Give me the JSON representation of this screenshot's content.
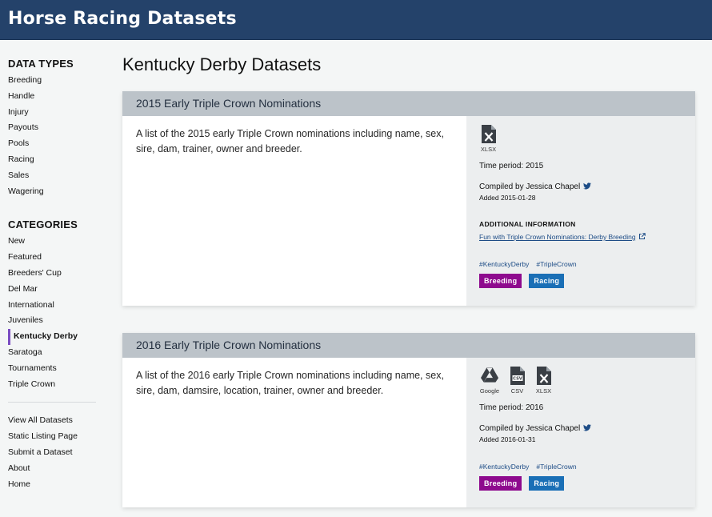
{
  "header": {
    "title": "Horse Racing Datasets"
  },
  "sidebar": {
    "data_types_heading": "DATA TYPES",
    "data_types": [
      "Breeding",
      "Handle",
      "Injury",
      "Payouts",
      "Pools",
      "Racing",
      "Sales",
      "Wagering"
    ],
    "categories_heading": "CATEGORIES",
    "categories": [
      "New",
      "Featured",
      "Breeders' Cup",
      "Del Mar",
      "International",
      "Juveniles",
      "Kentucky Derby",
      "Saratoga",
      "Tournaments",
      "Triple Crown"
    ],
    "active_category": "Kentucky Derby",
    "links": [
      "View All Datasets",
      "Static Listing Page",
      "Submit a Dataset",
      "About",
      "Home"
    ]
  },
  "main": {
    "title": "Kentucky Derby Datasets",
    "datasets": [
      {
        "title": "2015 Early Triple Crown Nominations",
        "description": "A list of the 2015 early Triple Crown nominations including name, sex, sire, dam, trainer, owner and breeder.",
        "files": [
          {
            "icon": "xlsx-file-icon",
            "label": "XLSX"
          }
        ],
        "time_period": "Time period: 2015",
        "compiled_by": "Compiled by Jessica Chapel",
        "added": "Added 2015-01-28",
        "additional_info_heading": "ADDITIONAL INFORMATION",
        "additional_info_link": "Fun with Triple Crown Nominations: Derby Breeding",
        "hashtags": [
          "#KentuckyDerby",
          "#TripleCrown"
        ],
        "categories": [
          {
            "label": "Breeding",
            "color": "#8e0a8e"
          },
          {
            "label": "Racing",
            "color": "#1a6fb6"
          }
        ]
      },
      {
        "title": "2016 Early Triple Crown Nominations",
        "description": "A list of the 2016 early Triple Crown nominations including name, sex, sire, dam, damsire, location, trainer, owner and breeder.",
        "files": [
          {
            "icon": "google-drive-icon",
            "label": "Google"
          },
          {
            "icon": "csv-file-icon",
            "label": "CSV"
          },
          {
            "icon": "xlsx-file-icon",
            "label": "XLSX"
          }
        ],
        "time_period": "Time period: 2016",
        "compiled_by": "Compiled by Jessica Chapel",
        "added": "Added 2016-01-31",
        "hashtags": [
          "#KentuckyDerby",
          "#TripleCrown"
        ],
        "categories": [
          {
            "label": "Breeding",
            "color": "#8e0a8e"
          },
          {
            "label": "Racing",
            "color": "#1a6fb6"
          }
        ]
      }
    ]
  },
  "colors": {
    "header_bg": "#24426a",
    "card_header_bg": "#bcc3c9",
    "card_side_bg": "#eceeef",
    "active_marker": "#7a4cc2",
    "link": "#1d4c86"
  }
}
